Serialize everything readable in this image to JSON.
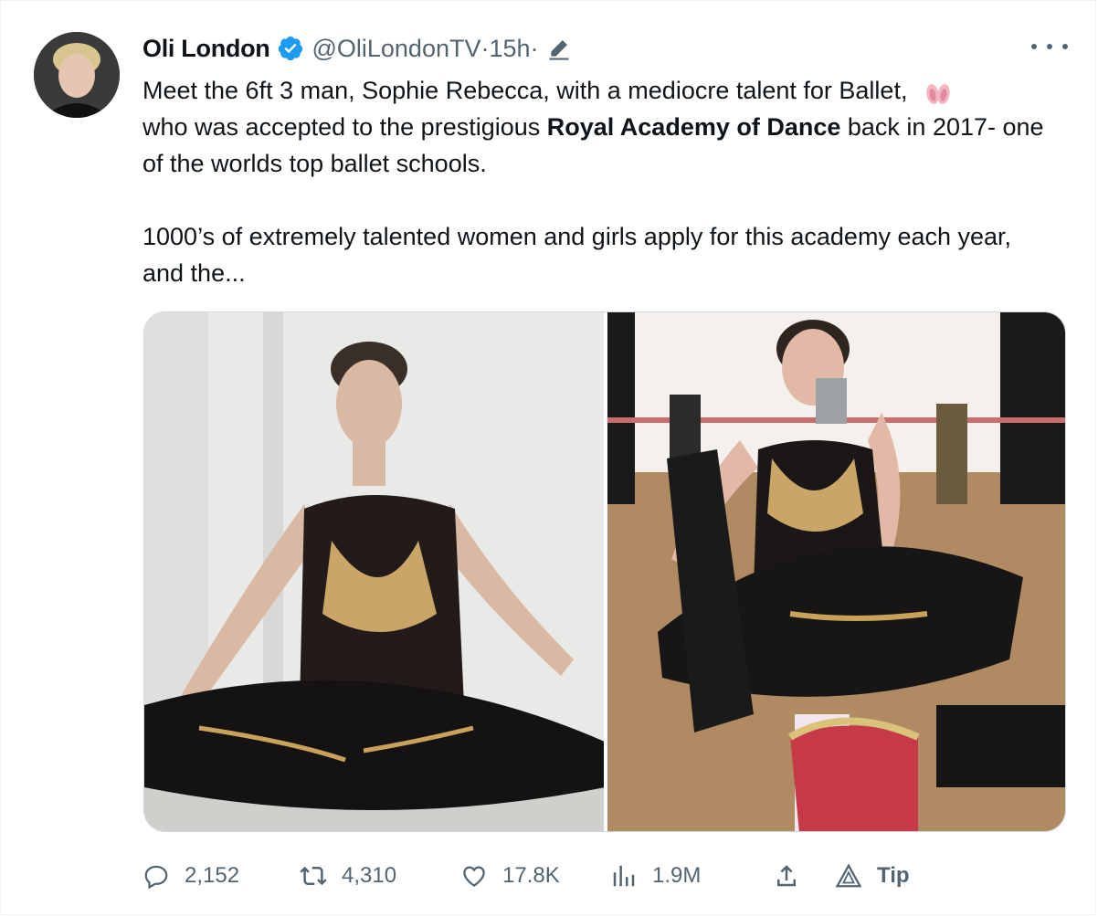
{
  "tweet": {
    "author_name": "Oli London",
    "handle": "@OliLondonTV",
    "separator1": " · ",
    "time": "15h",
    "separator2": " ·",
    "text_para1_before_bold": "Meet the 6ft 3 man, Sophie Rebecca, with a mediocre talent for Ballet, ",
    "text_para1_line2_before_bold": "who was accepted to the prestigious ",
    "text_bold": "Royal Academy of Dance",
    "text_para1_after_bold": " back in 2017- one of the worlds top ballet schools.",
    "text_para2": "1000’s of extremely talented women and girls apply for this academy each year, and the..."
  },
  "actions": {
    "replies": "2,152",
    "retweets": "4,310",
    "likes": "17.8K",
    "views": "1.9M",
    "tip_label": "Tip"
  },
  "icons": {
    "verified": "verified-badge-icon",
    "edit": "pen-icon",
    "more": "more-dots-icon",
    "emoji": "ballet-shoes-emoji",
    "reply": "reply-bubble-icon",
    "retweet": "retweet-icon",
    "like": "heart-icon",
    "views": "bar-chart-icon",
    "share": "share-upload-icon",
    "tip": "tip-triangle-icon"
  },
  "colors": {
    "text": "#0f1419",
    "secondary": "#536471",
    "verified_blue": "#1d9bf0",
    "border": "#cfd9de"
  }
}
